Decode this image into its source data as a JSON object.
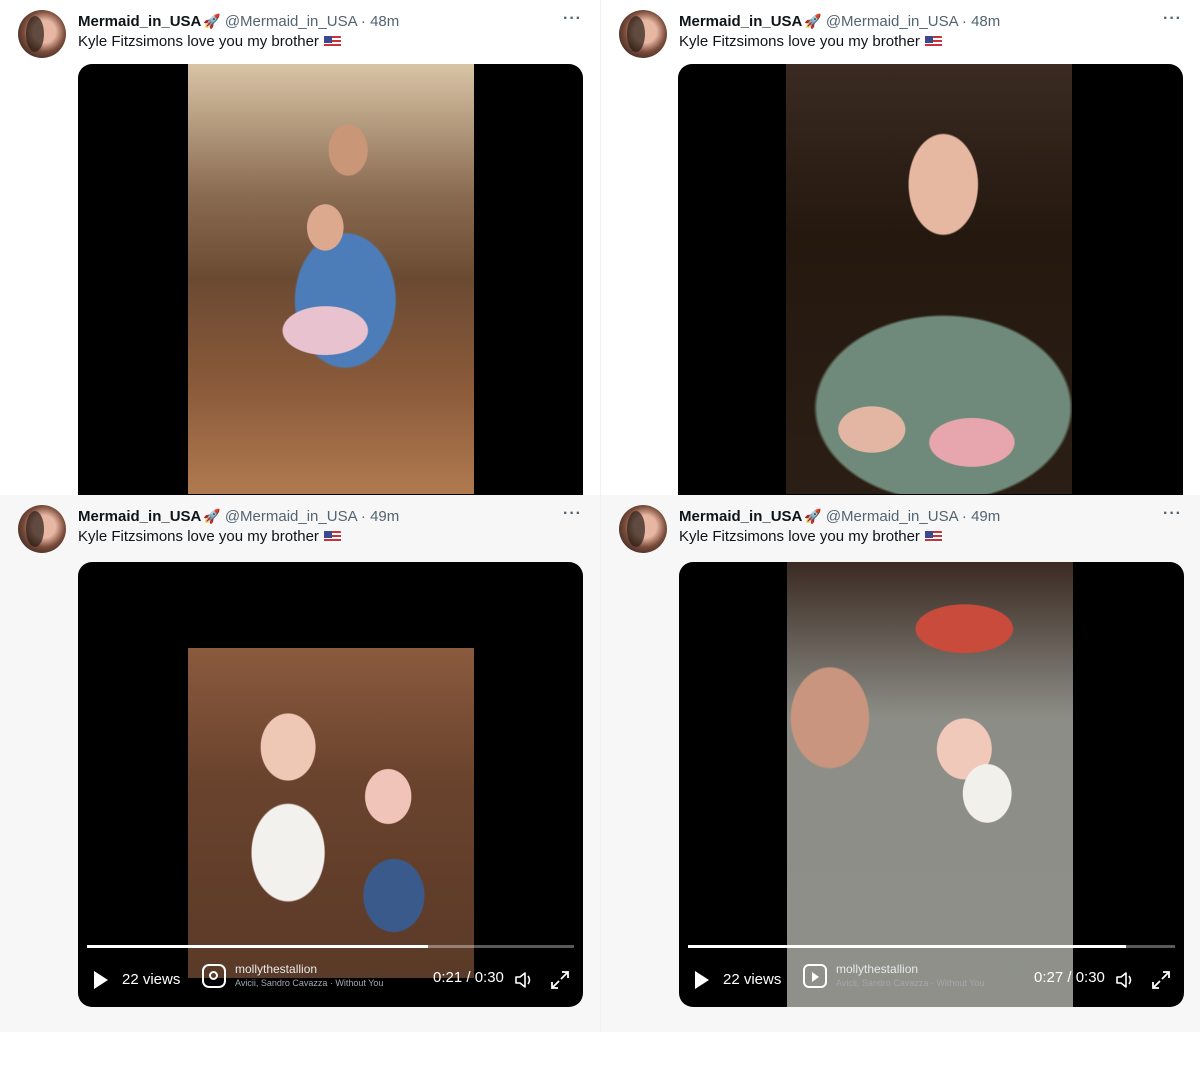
{
  "tweets": [
    {
      "name": "Mermaid_in_USA",
      "rocket": "🚀",
      "handle": "@Mermaid_in_USA · 48m",
      "text": "Kyle Fitzsimons love you my brother",
      "media_type": "video",
      "has_controls": false
    },
    {
      "name": "Mermaid_in_USA",
      "rocket": "🚀",
      "handle": "@Mermaid_in_USA · 48m",
      "text": "Kyle Fitzsimons love you my brother",
      "media_type": "video",
      "has_controls": false
    },
    {
      "name": "Mermaid_in_USA",
      "rocket": "🚀",
      "handle": "@Mermaid_in_USA · 49m",
      "text": "Kyle Fitzsimons love you my brother",
      "media_type": "video",
      "has_controls": true,
      "controls": {
        "views": "22 views",
        "author": "mollythestallion",
        "song": "Avicii, Sandro Cavazza · Without You",
        "time": "0:21 / 0:30",
        "progress": 0.7,
        "source_icon": "instagram-icon"
      }
    },
    {
      "name": "Mermaid_in_USA",
      "rocket": "🚀",
      "handle": "@Mermaid_in_USA · 49m",
      "text": "Kyle Fitzsimons love you my brother",
      "media_type": "video",
      "has_controls": true,
      "controls": {
        "views": "22 views",
        "author": "mollythestallion",
        "song": "Avicii, Sandro Cavazza · Without You",
        "time": "0:27 / 0:30",
        "progress": 0.9,
        "source_icon": "reels-icon"
      }
    }
  ],
  "more_icon": "more-options-icon",
  "flag_icon": "us-flag-icon"
}
